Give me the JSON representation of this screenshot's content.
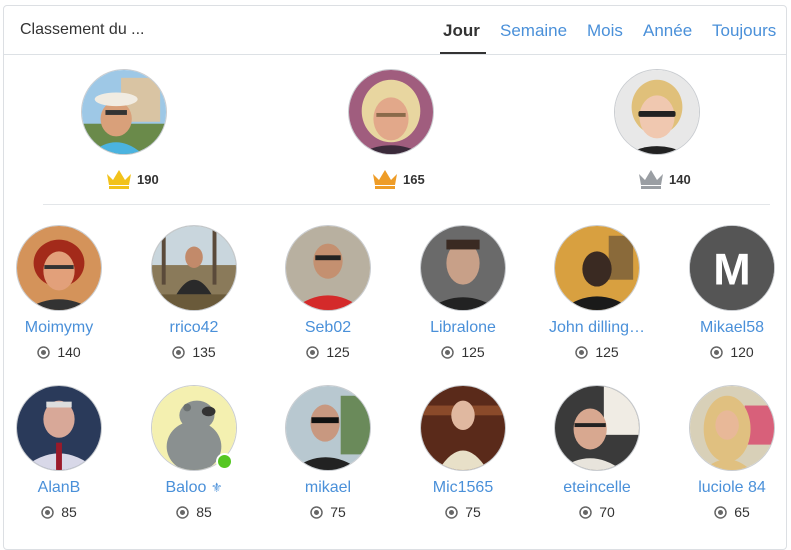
{
  "widget": {
    "title": "Classement du ..."
  },
  "tabs": [
    {
      "label": "Jour",
      "active": true
    },
    {
      "label": "Semaine"
    },
    {
      "label": "Mois"
    },
    {
      "label": "Année"
    },
    {
      "label": "Toujours"
    }
  ],
  "podium": [
    {
      "score": "190",
      "crown": "gold-crown-icon",
      "crown_color": "#f2c21b",
      "avatar_bg": "#9ec8e6"
    },
    {
      "score": "165",
      "crown": "orange-crown-icon",
      "crown_color": "#ee9c27",
      "avatar_bg": "#a05d7e"
    },
    {
      "score": "140",
      "crown": "silver-crown-icon",
      "crown_color": "#9a9ea3",
      "avatar_bg": "#e8e8e8"
    }
  ],
  "rows": [
    [
      {
        "name": "Moimymy",
        "points": "140"
      },
      {
        "name": "rrico42",
        "points": "135"
      },
      {
        "name": "Seb02",
        "points": "125"
      },
      {
        "name": "Libralone",
        "points": "125"
      },
      {
        "name": "John dilling…",
        "points": "125"
      },
      {
        "name": "Mikael58",
        "points": "120",
        "initial": "M"
      }
    ],
    [
      {
        "name": "AlanB",
        "points": "85"
      },
      {
        "name": "Baloo",
        "points": "85",
        "badge": "⚜",
        "online": true
      },
      {
        "name": "mikael",
        "points": "75"
      },
      {
        "name": "Mic1565",
        "points": "75"
      },
      {
        "name": "eteincelle",
        "points": "70"
      },
      {
        "name": "luciole 84",
        "points": "65"
      }
    ]
  ],
  "colors": {
    "link": "#4a90d9",
    "online": "#55c722"
  }
}
